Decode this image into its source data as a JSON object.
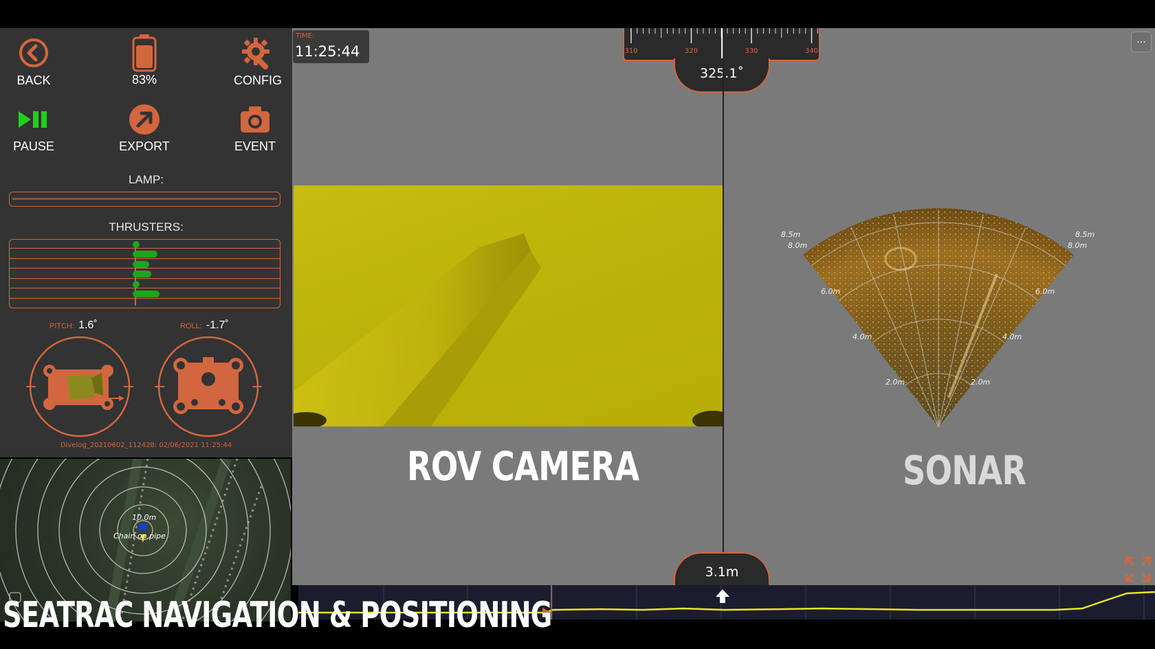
{
  "toolbar": {
    "back_label": "BACK",
    "battery_label": "83%",
    "battery_level": 0.83,
    "config_label": "CONFIG",
    "pause_label": "PAUSE",
    "export_label": "EXPORT",
    "event_label": "EVENT"
  },
  "lamp": {
    "label": "LAMP:",
    "level": 0
  },
  "thrusters": {
    "label": "THRUSTERS:",
    "values": [
      0,
      0.12,
      0.08,
      0.09,
      0,
      0.13
    ]
  },
  "attitude": {
    "pitch_key": "PITCH:",
    "pitch_value": "1.6˚",
    "roll_key": "ROLL:",
    "roll_value": "-1.7˚"
  },
  "divelog": "Divelog_20210602_112428: 02/06/2021 11:25:44",
  "map": {
    "range_label": "10.0m",
    "poi_label": "Chain on pipe"
  },
  "time": {
    "key": "TIME:",
    "value": "11:25:44"
  },
  "compass": {
    "ticks": [
      "310",
      "320",
      "330",
      "340"
    ],
    "heading": "325.1˚"
  },
  "menu_label": "...",
  "overlays": {
    "camera_title": "ROV CAMERA",
    "sonar_title": "SONAR"
  },
  "sonar": {
    "ranges_left": [
      "8.5m",
      "8.0m",
      "6.0m",
      "4.0m",
      "2.0m"
    ],
    "ranges_right": [
      "8.5m",
      "8.0m",
      "6.0m",
      "4.0m",
      "2.0m"
    ]
  },
  "depth": {
    "value": "3.1m"
  },
  "caption": "SEATRAC NAVIGATION & POSITIONING",
  "colors": {
    "accent": "#d2663f",
    "go": "#1ea51e",
    "depth_line": "#e8e81a"
  }
}
